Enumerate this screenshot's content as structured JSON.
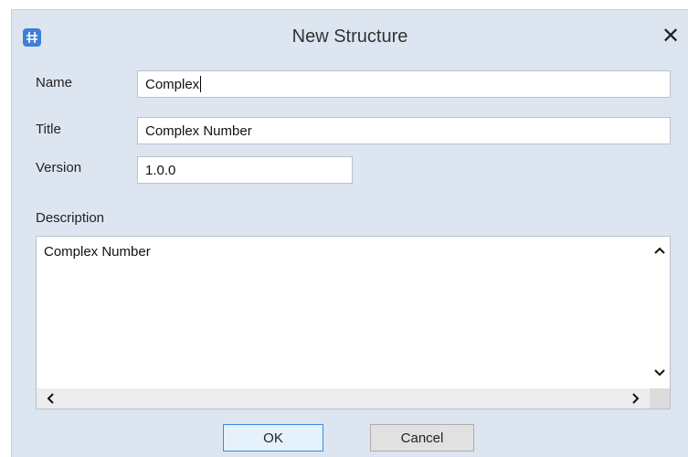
{
  "window": {
    "title": "New Structure",
    "close_glyph": "✕",
    "app_icon": "structure-grid-icon"
  },
  "form": {
    "name_label": "Name",
    "name_value": "Complex",
    "title_label": "Title",
    "title_value": "Complex Number",
    "version_label": "Version",
    "version_value": "1.0.0",
    "description_label": "Description",
    "description_value": "Complex Number"
  },
  "scroll": {
    "up_icon": "chevron-up-icon",
    "down_icon": "chevron-down-icon",
    "left_icon": "chevron-left-icon",
    "right_icon": "chevron-right-icon"
  },
  "buttons": {
    "ok_label": "OK",
    "cancel_label": "Cancel"
  },
  "colors": {
    "dialog_bg": "#dde6f0",
    "accent": "#3c8bdc",
    "app_icon": "#3f7fd8"
  }
}
